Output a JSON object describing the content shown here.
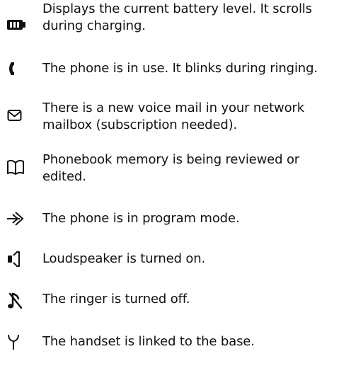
{
  "icon_list": {
    "items": [
      {
        "icon": "battery-icon",
        "lines": [
          "Displays the current battery level. It scrolls",
          "during charging."
        ]
      },
      {
        "icon": "phone-in-use-icon",
        "lines": [
          "The phone is in use. It blinks during ringing."
        ]
      },
      {
        "icon": "voicemail-envelope-icon",
        "lines": [
          "There is a new voice mail in your network",
          "mailbox (subscription needed)."
        ]
      },
      {
        "icon": "phonebook-icon",
        "lines": [
          "Phonebook memory is being reviewed or",
          "edited."
        ]
      },
      {
        "icon": "program-mode-arrow-icon",
        "lines": [
          "The phone is in program mode."
        ]
      },
      {
        "icon": "loudspeaker-icon",
        "lines": [
          "Loudspeaker is turned on."
        ]
      },
      {
        "icon": "ringer-off-icon",
        "lines": [
          "The ringer is turned off."
        ]
      },
      {
        "icon": "antenna-icon",
        "lines": [
          "The handset is linked to the base."
        ]
      }
    ]
  }
}
